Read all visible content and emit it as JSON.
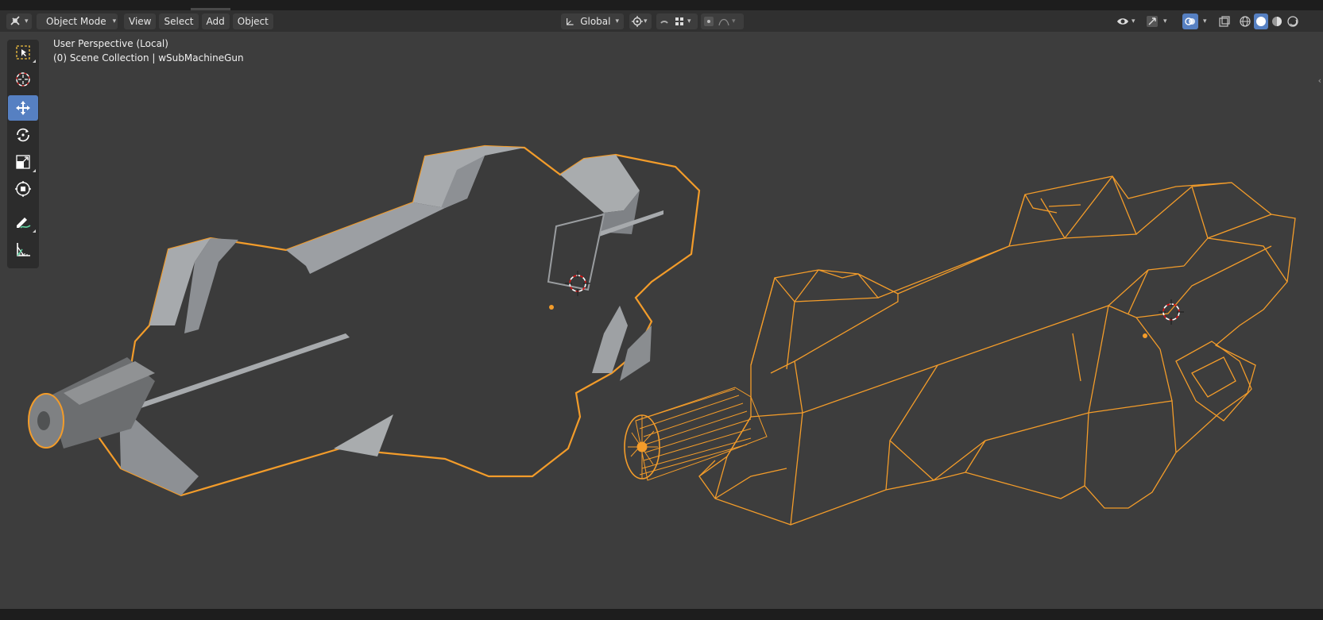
{
  "header": {
    "editor_icon": "editor-type-icon",
    "mode": "Object Mode",
    "menus": [
      "View",
      "Select",
      "Add",
      "Object"
    ],
    "orientation": "Global"
  },
  "viewport": {
    "view_name": "User Perspective (Local)",
    "collection": "(0) Scene Collection | wSubMachineGun"
  },
  "toolbar": {
    "tools": [
      "select-box-icon",
      "cursor-icon",
      "move-icon",
      "rotate-icon",
      "scale-icon",
      "transform-icon",
      "annotate-icon",
      "measure-icon"
    ],
    "active_tool": "move-icon"
  },
  "colors": {
    "accent": "#5680c2",
    "selection_outline": "#f39c2a",
    "viewport_bg": "#3d3d3d",
    "header_bg": "#303030"
  }
}
